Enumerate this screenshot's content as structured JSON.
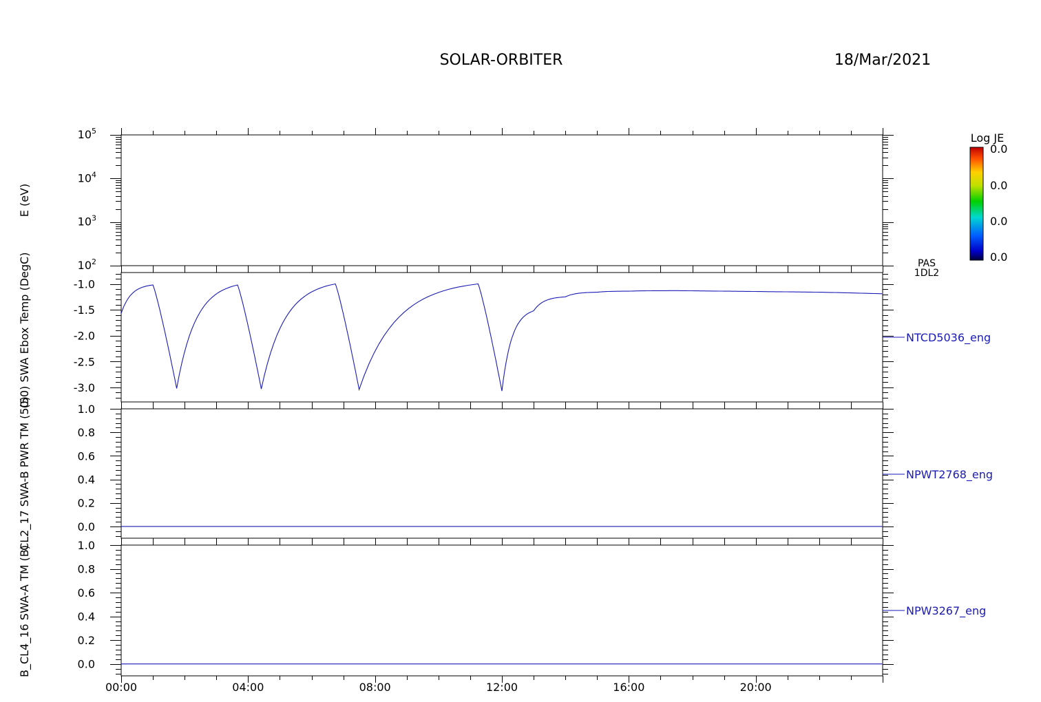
{
  "header": {
    "title": "SOLAR-ORBITER",
    "date": "18/Mar/2021"
  },
  "colorbar": {
    "title": "Log JE",
    "ticks": [
      "0.0",
      "0.0",
      "0.0",
      "0.0"
    ],
    "subtitle_1": "PAS",
    "subtitle_2": "1DL2"
  },
  "chart_data": [
    {
      "type": "heatmap",
      "ylabel": "E (eV)",
      "yscale": "log",
      "ylim": [
        100,
        100000
      ],
      "ytick_labels": [
        {
          "value": 100,
          "label": "10",
          "exp": "2"
        },
        {
          "value": 1000,
          "label": "10",
          "exp": "3"
        },
        {
          "value": 10000,
          "label": "10",
          "exp": "4"
        },
        {
          "value": 100000,
          "label": "10",
          "exp": "5"
        }
      ],
      "values": []
    },
    {
      "type": "line",
      "ylabel": "(50) SWA Ebox Temp (DegC)",
      "series_label": "NTCD5036_eng",
      "ylim": [
        -3.28,
        -0.78
      ],
      "yticks": [
        -1.0,
        -1.5,
        -2.0,
        -2.5,
        -3.0
      ],
      "ytick_labels": [
        "-1.0",
        "-1.5",
        "-2.0",
        "-2.5",
        "-3.0"
      ],
      "series": [
        {
          "x": [
            "00:00",
            "01:00",
            "01:45",
            "03:40",
            "04:25",
            "06:45",
            "07:30",
            "11:15",
            "12:00",
            "13:00",
            "14:00",
            "15:00",
            "16:00",
            "17:30",
            "19:00",
            "20:30",
            "22:00",
            "23:59"
          ],
          "y": [
            -1.57,
            -1.02,
            -3.02,
            -1.02,
            -3.03,
            -1.0,
            -3.04,
            -1.0,
            -3.07,
            -1.52,
            -1.25,
            -1.16,
            -1.14,
            -1.13,
            -1.14,
            -1.15,
            -1.16,
            -1.19
          ]
        }
      ]
    },
    {
      "type": "line",
      "ylabel": "CL2_17 SWA-B PWR TM (50)",
      "series_label": "NPWT2768_eng",
      "ylim": [
        -0.1,
        1.0
      ],
      "yticks": [
        0.0,
        0.2,
        0.4,
        0.6,
        0.8,
        1.0
      ],
      "ytick_labels": [
        "0.0",
        "0.2",
        "0.4",
        "0.6",
        "0.8",
        "1.0"
      ],
      "series": [
        {
          "x": [
            "00:00",
            "23:59"
          ],
          "y": [
            0.0,
            0.0
          ]
        }
      ]
    },
    {
      "type": "line",
      "ylabel": "B_CL4_16 SWA-A TM (B)",
      "series_label": "NPW3267_eng",
      "ylim": [
        -0.1,
        1.0
      ],
      "yticks": [
        0.0,
        0.2,
        0.4,
        0.6,
        0.8,
        1.0
      ],
      "ytick_labels": [
        "0.0",
        "0.2",
        "0.4",
        "0.6",
        "0.8",
        "1.0"
      ],
      "series": [
        {
          "x": [
            "00:00",
            "23:59"
          ],
          "y": [
            0.0,
            0.0
          ]
        }
      ]
    }
  ],
  "time_axis": {
    "range_hours": [
      0,
      24
    ],
    "major_ticks": [
      "00:00",
      "04:00",
      "08:00",
      "12:00",
      "16:00",
      "20:00"
    ]
  },
  "colors": {
    "trace": "#1a1ab5",
    "axes": "#000000"
  }
}
